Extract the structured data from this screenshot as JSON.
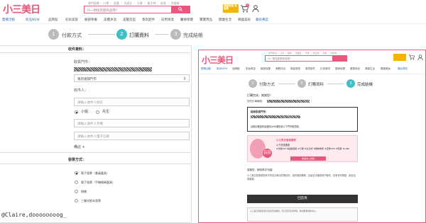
{
  "header": {
    "logo": "小三美日",
    "hot_keywords": "熱門搜尋｜ 口罩 ｜ 面膜 ｜ 洗面乳 ｜ 牙膏 ｜ 衛生棉 ｜ 卸妝 ｜ 洗髮精",
    "search_placeholder": "Hi~想找甚麼商品嗎？",
    "free_shipping": "滿額免運 免運費",
    "cart_count": "0"
  },
  "nav": {
    "items": [
      "雙購活動",
      "新品NEW",
      "品牌館",
      "彩妝美容",
      "臉部保養",
      "美體沐浴",
      "美髮造型",
      "香氛配件",
      "日用清潔",
      "醫療保健",
      "寶寶用品",
      "健康生活",
      "韓國美妝",
      "藥妝專區"
    ]
  },
  "steps": [
    {
      "num": "1",
      "label": "付款方式"
    },
    {
      "num": "2",
      "label": "訂購資料"
    },
    {
      "num": "3",
      "label": "完成結帳"
    }
  ],
  "form": {
    "recipient_section": "收件資料：",
    "store_label": "取貨門市：",
    "store_button": "重新選擇門市",
    "recipient_label": "收件人：",
    "name_placeholder": "請輸入收件人姓名",
    "gender_female": "小姐",
    "gender_male": "先生",
    "phone_placeholder": "請輸入收件人手機",
    "email_placeholder": "請輸入收件人電子信箱",
    "note_label": "備註 +",
    "payment_section": "發票方式：",
    "invoice_options": [
      "電子發票（會員載具）",
      "電子發票（手機條碼載具）",
      "捐贈",
      "三聯式紙本發票"
    ]
  },
  "right": {
    "logo": "小三美日",
    "hot_keywords": "熱門搜尋｜ 口罩 ｜ 面膜 ｜ 洗面乳 ｜ 牙膏 ｜ 衛生棉 ｜ 卸妝 ｜ 洗髮精",
    "search_placeholder": "Hi~想找甚麼商品嗎？",
    "nav": [
      "雙購活動",
      "新品NEW",
      "品牌館",
      "彩妝美容",
      "臉部保養",
      "美體沐浴",
      "美髮造型",
      "香氛配件",
      "日用清潔",
      "醫療保健",
      "寶寶用品",
      "健康生活",
      "韓國美妝",
      "藥妝專區"
    ],
    "thanks": "訂購完成，謝謝您！",
    "order_no": "您的訂單編號：",
    "store_title": "超商取貨門市：",
    "store_note": "請務必確認商品通知LINE通知到以下門市取貨喔。",
    "member_title": "小三美日會員獨享",
    "member_sub": "以下好康優惠",
    "member_items": "★會員VIP ★點數回饋 ★分期 ★生日禮 ★購物優惠 ★直營ATM ★限量 ★LINE",
    "member_button": "快速加入會員",
    "badge": "官方會員 優惠活動",
    "contact_title": "感謝您，期待再次光臨！",
    "contact_text": "小三美日若發現您有不符合訂單出貨等情形，將會與您聯繫，請留意手機或電子郵件；如有任何問題，歡迎洽詢客服。",
    "home_button": "回首頁",
    "footer_text": "小三美日保留接受訂單與否的權利。若訂單有任何問題，歡迎聯繫客服中心。"
  },
  "watermark": "@Claire,doooooooog_"
}
